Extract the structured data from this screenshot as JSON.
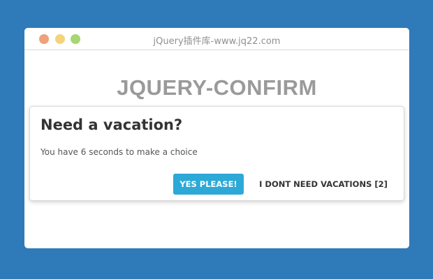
{
  "window": {
    "title": "jQuery插件库-www.jq22.com",
    "controls": {
      "close": "close-dot",
      "minimize": "minimize-dot",
      "maximize": "maximize-dot"
    }
  },
  "page": {
    "heading": "JQUERY-CONFIRM"
  },
  "dialog": {
    "title": "Need a vacation?",
    "message": "You have 6 seconds to make a choice",
    "confirm_label": "YES PLEASE!",
    "cancel_label": "I DONT NEED VACATIONS [2]"
  },
  "colors": {
    "background": "#2f7ab8",
    "window_bg": "#ffffff",
    "close_dot": "#f0a07a",
    "minimize_dot": "#f4d47a",
    "maximize_dot": "#a8d672",
    "heading": "#9a9a9a",
    "confirm_button": "#2ca9d6",
    "dialog_title": "#333333"
  }
}
